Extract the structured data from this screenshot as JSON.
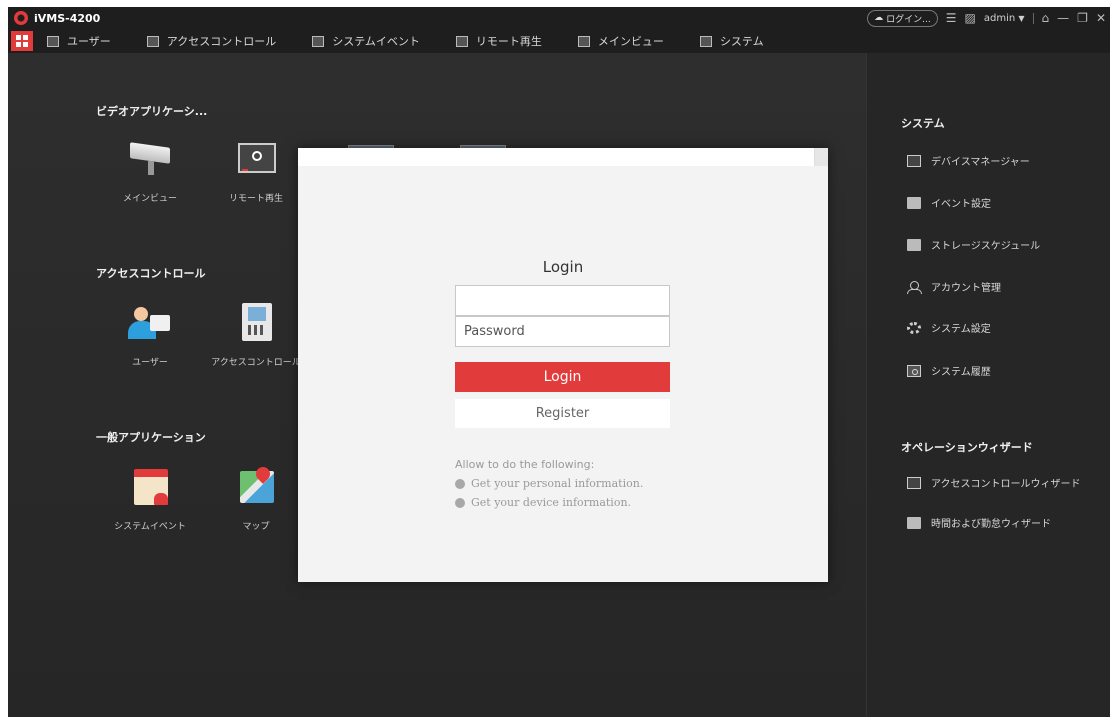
{
  "app": {
    "title": "iVMS-4200"
  },
  "titlebar": {
    "login_pill": "ログイン...",
    "user": "admin",
    "user_caret": "▼",
    "lock_icon": "lock-icon",
    "min_glyph": "—",
    "restore_glyph": "❐",
    "close_glyph": "✕"
  },
  "nav": {
    "items": [
      {
        "label": "ユーザー",
        "icon": "user-card-icon"
      },
      {
        "label": "アクセスコントロール",
        "icon": "door-icon"
      },
      {
        "label": "システムイベント",
        "icon": "alarm-icon"
      },
      {
        "label": "リモート再生",
        "icon": "playback-icon"
      },
      {
        "label": "メインビュー",
        "icon": "camera-icon"
      },
      {
        "label": "システム",
        "icon": "system-icon"
      }
    ]
  },
  "main": {
    "sections": {
      "video": "ビデオアプリケーシ...",
      "access": "アクセスコントロール",
      "general": "一般アプリケーション"
    },
    "tiles": {
      "main_view": "メインビュー",
      "remote_playback": "リモート再生",
      "users": "ユーザー",
      "access_control": "アクセスコントロール",
      "system_event": "システムイベント",
      "map": "マップ"
    }
  },
  "login": {
    "title": "Login",
    "username_value": "",
    "password_placeholder": "Password",
    "login_button": "Login",
    "register_button": "Register",
    "permissions_title": "Allow to do the following:",
    "permissions": [
      "Get your personal information.",
      "Get your device information."
    ]
  },
  "right": {
    "system_title": "システム",
    "system_items": [
      {
        "label": "デバイスマネージャー",
        "icon": "device-manager-icon"
      },
      {
        "label": "イベント設定",
        "icon": "event-settings-icon"
      },
      {
        "label": "ストレージスケジュール",
        "icon": "storage-icon"
      },
      {
        "label": "アカウント管理",
        "icon": "account-icon"
      },
      {
        "label": "システム設定",
        "icon": "gear-icon"
      },
      {
        "label": "システム履歴",
        "icon": "log-icon"
      }
    ],
    "wizard_title": "オペレーションウィザード",
    "wizard_items": [
      {
        "label": "アクセスコントロールウィザード",
        "icon": "door-wizard-icon"
      },
      {
        "label": "時間および勤怠ウィザード",
        "icon": "calendar-icon"
      }
    ]
  },
  "colors": {
    "accent": "#e23b3b",
    "background": "#2b2b2b",
    "dialog": "#f3f3f3"
  }
}
